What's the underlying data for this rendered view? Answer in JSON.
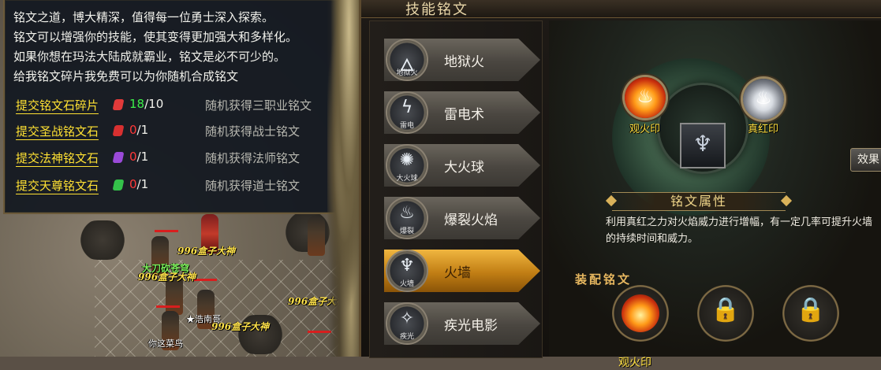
{
  "npc_dialog": {
    "intro_lines": [
      "铭文之道，博大精深，值得每一位勇士深入探索。",
      "铭文可以增强你的技能，使其变得更加强大和多样化。",
      "如果你想在玛法大陆成就霸业，铭文是必不可少的。",
      "给我铭文碎片我免费可以为你随机合成铭文"
    ],
    "options": [
      {
        "link": "提交铭文石碎片",
        "have": "18",
        "need": "/10",
        "desc": "随机获得三职业铭文",
        "gem_color": "#e23a3a"
      },
      {
        "link": "提交圣战铭文石",
        "have": "0",
        "need": "/1",
        "desc": "随机获得战士铭文",
        "gem_color": "#d83030"
      },
      {
        "link": "提交法神铭文石",
        "have": "0",
        "need": "/1",
        "desc": "随机获得法师铭文",
        "gem_color": "#9a4ad8"
      },
      {
        "link": "提交天尊铭文石",
        "have": "0",
        "need": "/1",
        "desc": "随机获得道士铭文",
        "gem_color": "#34c24a"
      }
    ]
  },
  "world": {
    "nicknames": [
      "996盒子大神",
      "996盒子大神",
      "996盒子大神",
      "996盒子大神"
    ],
    "guild_tag": "大刀砍苍穹",
    "player_star": "★浩南哥",
    "player_low": "你这菜鸟",
    "hp_color": "#d81e1e"
  },
  "panel": {
    "title": "技能铭文",
    "skills": [
      {
        "name": "地狱火",
        "icon_text": "地狱火",
        "icon": "hellfire-icon",
        "glyph": "🜂"
      },
      {
        "name": "雷电术",
        "icon_text": "雷电",
        "icon": "lightning-icon",
        "glyph": "ϟ"
      },
      {
        "name": "大火球",
        "icon_text": "大火球",
        "icon": "fireball-icon",
        "glyph": "✺"
      },
      {
        "name": "爆裂火焰",
        "icon_text": "爆裂",
        "icon": "burst-flame-icon",
        "glyph": "♨"
      },
      {
        "name": "火墙",
        "icon_text": "火墙",
        "icon": "firewall-icon",
        "glyph": "♆"
      },
      {
        "name": "疾光电影",
        "icon_text": "疾光",
        "icon": "lightning-beam-icon",
        "glyph": "✧"
      }
    ],
    "active_skill_index": 4,
    "seal_left": {
      "label": "观火印",
      "color": "#ffe040"
    },
    "seal_right": {
      "label": "真红印",
      "color": "#ffe040"
    },
    "effect_button": "效果",
    "attr_title": "铭文属性",
    "attr_desc": "利用真红之力对火焰威力进行增幅，有一定几率可提升火墙的持续时间和威力。",
    "equip_label": "装配铭文",
    "equipped_slot_label": "观火印",
    "accent_color": "#f0b640"
  }
}
